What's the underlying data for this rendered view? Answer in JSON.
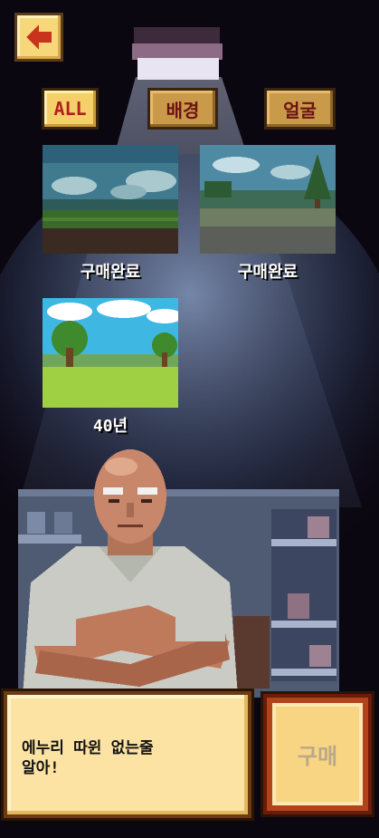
{
  "filters": {
    "all": "ALL",
    "background": "배경",
    "face": "얼굴"
  },
  "items": [
    {
      "label": "구매완료"
    },
    {
      "label": "구매완료"
    },
    {
      "label": "40년"
    }
  ],
  "dialog": {
    "text": "에누리 따윈 없는줄\n알아!"
  },
  "buy_button": {
    "label": "구매"
  }
}
